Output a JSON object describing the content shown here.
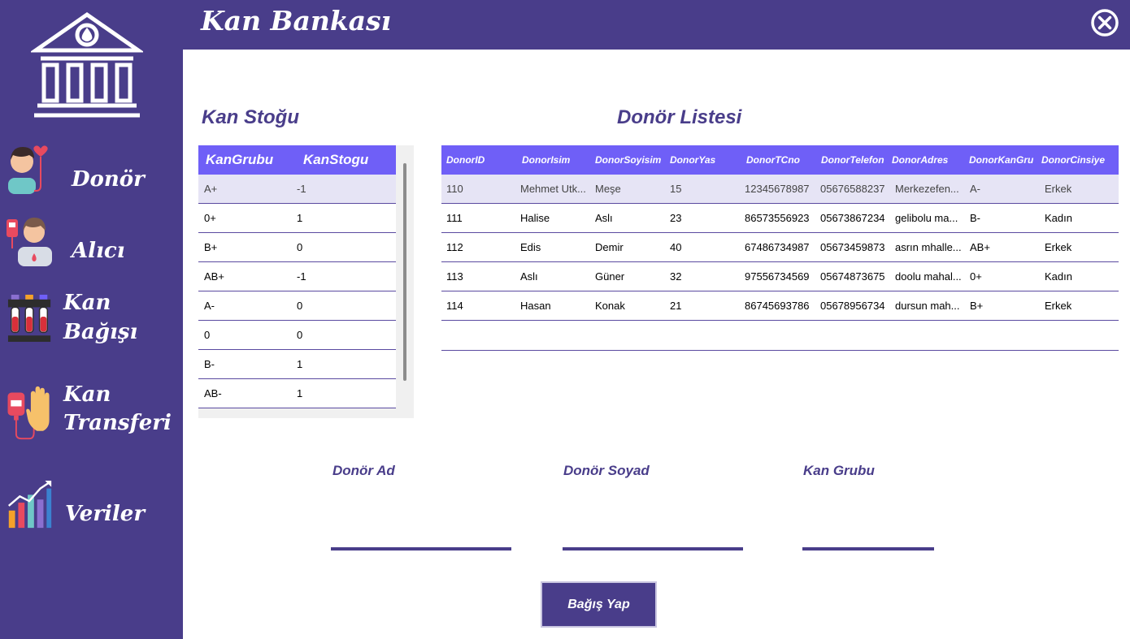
{
  "app": {
    "title": "Kan Bankası"
  },
  "sidebar": {
    "items": [
      {
        "label": "Donör"
      },
      {
        "label": "Alıcı"
      },
      {
        "label_line1": "Kan",
        "label_line2": "Bağışı"
      },
      {
        "label_line1": "Kan",
        "label_line2": "Transferi"
      },
      {
        "label": "Veriler"
      }
    ]
  },
  "stock": {
    "title": "Kan Stoğu",
    "columns": [
      "KanGrubu",
      "KanStogu"
    ],
    "rows": [
      [
        "A+",
        "-1"
      ],
      [
        "0+",
        "1"
      ],
      [
        "B+",
        "0"
      ],
      [
        "AB+",
        "-1"
      ],
      [
        "A-",
        "0"
      ],
      [
        "0",
        "0"
      ],
      [
        "B-",
        "1"
      ],
      [
        "AB-",
        "1"
      ]
    ]
  },
  "donors": {
    "title": "Donör Listesi",
    "columns": [
      "DonorID",
      "DonorIsim",
      "DonorSoyisim",
      "DonorYas",
      "DonorTCno",
      "DonorTelefon",
      "DonorAdres",
      "DonorKanGru",
      "DonorCinsiye"
    ],
    "rows": [
      [
        "110",
        "Mehmet Utk...",
        "Meşe",
        "15",
        "12345678987",
        "05676588237",
        "Merkezefen...",
        "A-",
        "Erkek"
      ],
      [
        "111",
        "Halise",
        "Aslı",
        "23",
        "86573556923",
        "05673867234",
        "gelibolu ma...",
        "B-",
        "Kadın"
      ],
      [
        "112",
        "Edis",
        "Demir",
        "40",
        "67486734987",
        "05673459873",
        "asrın mhalle...",
        "AB+",
        "Erkek"
      ],
      [
        "113",
        "Aslı",
        "Güner",
        "32",
        "97556734569",
        "05674873675",
        "doolu mahal...",
        "0+",
        "Kadın"
      ],
      [
        "114",
        "Hasan",
        "Konak",
        "21",
        "86745693786",
        "05678956734",
        "dursun mah...",
        "B+",
        "Erkek"
      ]
    ]
  },
  "form": {
    "donor_name_label": "Donör Ad",
    "donor_name_value": "",
    "donor_surname_label": "Donör Soyad",
    "donor_surname_value": "",
    "blood_group_label": "Kan Grubu",
    "blood_group_value": "",
    "donate_button": "Bağış Yap"
  },
  "colors": {
    "primary": "#493d8a",
    "header": "#6f5ff7",
    "selected_row": "#e6e4f5"
  }
}
